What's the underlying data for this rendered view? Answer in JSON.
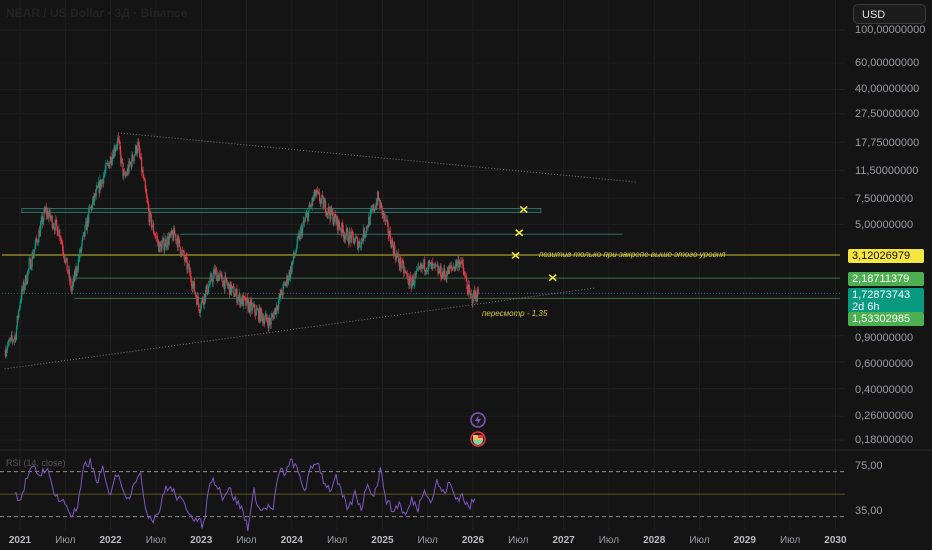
{
  "header": {
    "title": "NEAR / US Dollar · 3Д · Binance",
    "currency_button": "USD"
  },
  "price_axis": [
    "100,00000000",
    "60,00000000",
    "40,00000000",
    "27,50000000",
    "17,75000000",
    "11,50000000",
    "7,50000000",
    "5,00000000",
    "0,90000000",
    "0,60000000",
    "0,40000000",
    "0,26000000",
    "0,18000000"
  ],
  "badges": {
    "level_yellow": "3,12026979",
    "level_green_high": "2,18711379",
    "last_price": "1,72873743",
    "countdown": "2d 6h",
    "level_green_low": "1,53302985"
  },
  "annotations": {
    "positive_note": "позитив только при закрепе выше этого уровня",
    "review_note": "пересмотр - 1,35"
  },
  "time_axis": [
    {
      "label": "2021",
      "year": 2021.0,
      "bold": true
    },
    {
      "label": "Июл",
      "year": 2021.5
    },
    {
      "label": "2022",
      "year": 2022.0,
      "bold": true
    },
    {
      "label": "Июл",
      "year": 2022.5
    },
    {
      "label": "2023",
      "year": 2023.0,
      "bold": true
    },
    {
      "label": "Июл",
      "year": 2023.5
    },
    {
      "label": "2024",
      "year": 2024.0,
      "bold": true
    },
    {
      "label": "Июл",
      "year": 2024.5
    },
    {
      "label": "2025",
      "year": 2025.0,
      "bold": true
    },
    {
      "label": "Июл",
      "year": 2025.5
    },
    {
      "label": "2026",
      "year": 2026.0,
      "bold": true
    },
    {
      "label": "Июл",
      "year": 2026.5
    },
    {
      "label": "2027",
      "year": 2027.0,
      "bold": true
    },
    {
      "label": "Июл",
      "year": 2027.5
    },
    {
      "label": "2028",
      "year": 2028.0,
      "bold": true
    },
    {
      "label": "Июл",
      "year": 2028.5
    },
    {
      "label": "2029",
      "year": 2029.0,
      "bold": true
    },
    {
      "label": "Июл",
      "year": 2029.5
    },
    {
      "label": "2030",
      "year": 2030.0,
      "bold": true
    }
  ],
  "rsi": {
    "title": "RSI (14, close)",
    "axis": [
      "75,00",
      "35,00"
    ],
    "upper": 70,
    "middle": 50,
    "lower": 30
  },
  "colors": {
    "up": "#089981",
    "down": "#f23645",
    "yellow": "#f5e642",
    "green": "#4caf50",
    "teal": "#089981",
    "rsi": "#7e57c2"
  },
  "chart_data": {
    "type": "candlestick",
    "title": "NEAR / US Dollar · 3Д · Binance",
    "scale": "log",
    "ylim": [
      0.18,
      100
    ],
    "xlim": [
      2020.8,
      2030.05
    ],
    "price_path": [
      [
        2020.83,
        0.72
      ],
      [
        2020.95,
        0.9
      ],
      [
        2021.0,
        1.56
      ],
      [
        2021.28,
        6.2
      ],
      [
        2021.44,
        4.4
      ],
      [
        2021.57,
        1.8
      ],
      [
        2021.77,
        6.2
      ],
      [
        2022.08,
        18.4
      ],
      [
        2022.15,
        10
      ],
      [
        2022.3,
        17
      ],
      [
        2022.43,
        5.5
      ],
      [
        2022.54,
        3.5
      ],
      [
        2022.71,
        4.3
      ],
      [
        2022.87,
        2.4
      ],
      [
        2022.98,
        1.4
      ],
      [
        2023.15,
        2.4
      ],
      [
        2023.42,
        1.6
      ],
      [
        2023.76,
        1.1
      ],
      [
        2023.98,
        2.4
      ],
      [
        2024.09,
        4.3
      ],
      [
        2024.26,
        8
      ],
      [
        2024.37,
        6.6
      ],
      [
        2024.59,
        4.3
      ],
      [
        2024.75,
        3.7
      ],
      [
        2024.95,
        7.5
      ],
      [
        2025.14,
        3.2
      ],
      [
        2025.31,
        2.0
      ],
      [
        2025.47,
        2.7
      ],
      [
        2025.69,
        2.3
      ],
      [
        2025.86,
        2.9
      ],
      [
        2025.97,
        1.6
      ],
      [
        2026.06,
        1.73
      ]
    ],
    "levels": [
      {
        "price": 6.2,
        "from": 2021.02,
        "to": 2026.75,
        "color": "teal",
        "style": "zone"
      },
      {
        "price": 4.3,
        "from": 2022.77,
        "to": 2027.65,
        "color": "teal",
        "style": "solid"
      },
      {
        "price": 3.12026979,
        "from": 2020.8,
        "to": 2030.05,
        "color": "yellow",
        "style": "solid"
      },
      {
        "price": 2.18711379,
        "from": 2021.6,
        "to": 2030.05,
        "color": "green",
        "style": "solid"
      },
      {
        "price": 1.72873743,
        "from": 2020.8,
        "to": 2030.05,
        "color": "teal",
        "style": "dotted"
      },
      {
        "price": 1.6,
        "from": 2021.6,
        "to": 2030.05,
        "color": "green",
        "style": "solid"
      }
    ],
    "trendlines": [
      {
        "from": [
          2022.08,
          20.5
        ],
        "to": [
          2027.8,
          9.6
        ]
      },
      {
        "from": [
          2020.83,
          0.54
        ],
        "to": [
          2027.35,
          1.88
        ]
      }
    ],
    "markers": [
      [
        2026.56,
        6.3
      ],
      [
        2026.51,
        4.4
      ],
      [
        2026.47,
        3.1
      ],
      [
        2026.88,
        2.2
      ]
    ],
    "rsi_values": [
      50.7,
      46,
      65.5,
      73,
      67,
      74,
      56.6,
      45,
      42,
      31.4,
      37.4,
      74,
      78.8,
      61,
      71.5,
      47.7,
      68.5,
      59.6,
      45,
      62.6,
      65.5,
      33,
      28.5,
      36,
      56.6,
      53.7,
      46,
      40.3,
      33,
      25.5,
      22.6,
      62.6,
      61,
      47.7,
      55.2,
      45,
      37.4,
      21,
      52.2,
      34.4,
      38.9,
      36,
      71.5,
      68.5,
      80.3,
      68.5,
      53.7,
      71.5,
      80.3,
      62.6,
      53.7,
      64,
      47.7,
      36,
      50.7,
      37.4,
      61,
      47.7,
      71.5,
      45,
      34.4,
      42,
      30,
      45,
      37.4,
      56.6,
      42,
      61,
      50.7,
      59.6,
      46,
      49,
      37.4,
      46
    ],
    "rsi_range": [
      2020.94,
      2026.02
    ]
  }
}
